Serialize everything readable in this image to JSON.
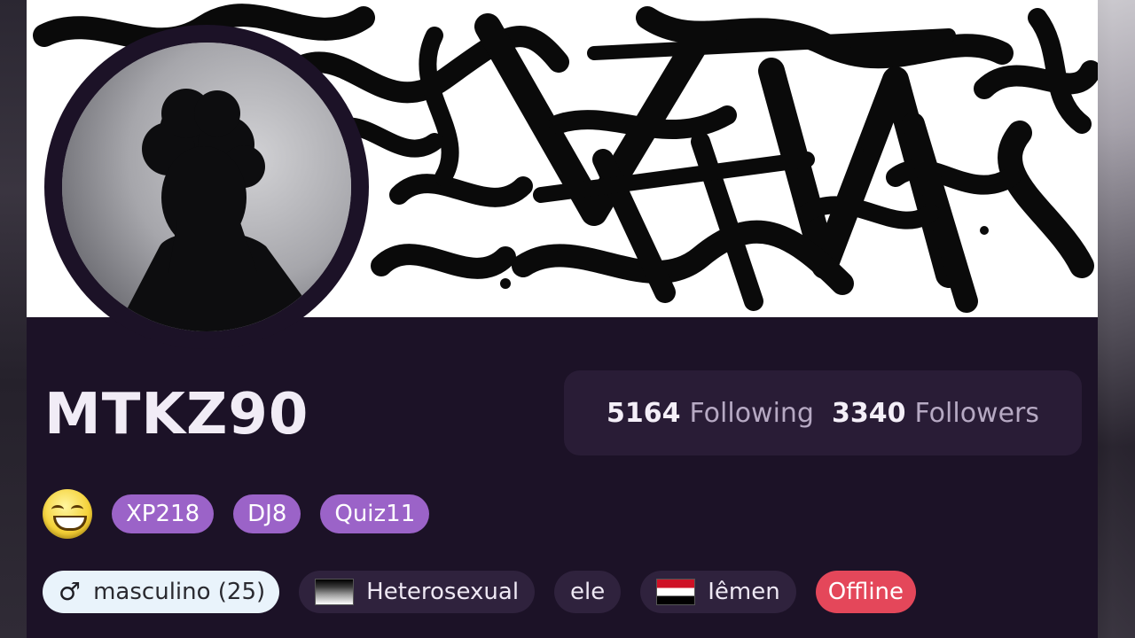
{
  "profile": {
    "username": "MTKZ90",
    "following_count": "5164",
    "following_label": "Following",
    "followers_count": "3340",
    "followers_label": "Followers"
  },
  "badges": [
    {
      "label": "XP218"
    },
    {
      "label": "DJ8"
    },
    {
      "label": "Quiz11"
    }
  ],
  "emoji_icon": "grinning-face-icon",
  "tags": {
    "gender": {
      "icon": "male-symbol-icon",
      "label": "masculino (25)"
    },
    "orientation": {
      "icon": "black-gray-flag-icon",
      "label": "Heterosexual"
    },
    "pronoun": {
      "label": "ele"
    },
    "country": {
      "icon": "yemen-flag-icon",
      "label": "Iêmen"
    },
    "status": {
      "label": "Offline",
      "color": "#e4475a"
    }
  },
  "colors": {
    "card_bg": "#1c1227",
    "stats_bg": "#291c36",
    "badge_purple": "#9b63c8",
    "offline_red": "#e4475a"
  }
}
